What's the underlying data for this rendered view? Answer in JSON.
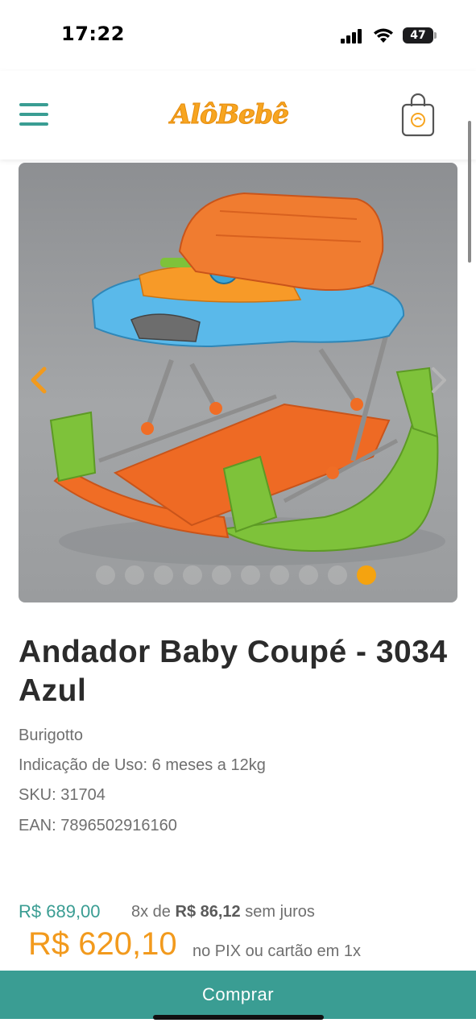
{
  "status_bar": {
    "time": "17:22",
    "battery_level": "47",
    "icons": [
      "signal-icon",
      "wifi-icon",
      "battery-icon"
    ]
  },
  "header": {
    "logo_text": "AlôBebê",
    "icons": [
      "menu-icon",
      "shopping-bag-icon"
    ]
  },
  "carousel": {
    "image_alt": "Andador Baby Coupé - 3034 Azul",
    "slide_count": 10,
    "active_slide": 10,
    "icons": [
      "chevron-left-icon",
      "chevron-right-icon"
    ]
  },
  "product": {
    "title": "Andador Baby Coupé - 3034 Azul",
    "brand": "Burigotto",
    "usage": "Indicação de Uso: 6 meses a 12kg",
    "sku": "SKU: 31704",
    "ean": "EAN: 7896502916160"
  },
  "pricing": {
    "old_price": "R$ 689,00",
    "installments_prefix": "8x de",
    "installment_value": "R$ 86,12",
    "installments_suffix": "sem juros",
    "pix_price": "R$ 620,10",
    "pix_label": "no PIX ou cartão em 1x"
  },
  "actions": {
    "buy_label": "Comprar"
  },
  "colors": {
    "brand_teal": "#3a9d93",
    "brand_orange": "#f29a1d",
    "logo_orange": "#f7a520"
  }
}
